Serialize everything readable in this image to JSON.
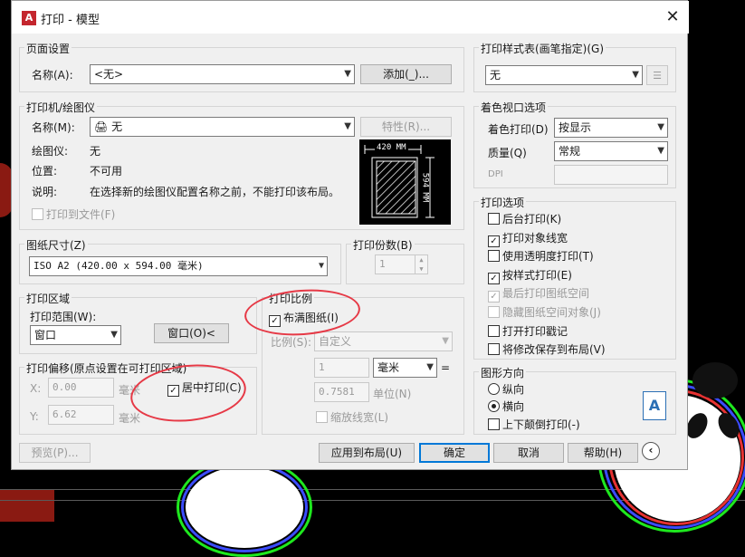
{
  "window": {
    "title": "打印 - 模型",
    "app_logo": "A",
    "close": "✕"
  },
  "page_setup": {
    "title": "页面设置",
    "name_label": "名称(A):",
    "name_value": "<无>",
    "add_button": "添加(_)..."
  },
  "printer": {
    "title": "打印机/绘图仪",
    "name_label": "名称(M):",
    "name_value": "无",
    "properties_button": "特性(R)...",
    "plotter_label": "绘图仪:",
    "plotter_value": "无",
    "location_label": "位置:",
    "location_value": "不可用",
    "description_label": "说明:",
    "description_value": "在选择新的绘图仪配置名称之前，不能打印该布局。",
    "print_to_file": "打印到文件(F)",
    "preview_width": "420 MM",
    "preview_height": "594 MM"
  },
  "paper_size": {
    "title": "图纸尺寸(Z)",
    "value": "ISO A2 (420.00 x 594.00 毫米)"
  },
  "copies": {
    "title": "打印份数(B)",
    "value": "1"
  },
  "plot_area": {
    "title": "打印区域",
    "range_label": "打印范围(W):",
    "range_value": "窗口",
    "window_button": "窗口(O)<"
  },
  "plot_offset": {
    "title": "打印偏移(原点设置在可打印区域)",
    "x_label": "X:",
    "x_value": "0.00",
    "x_unit": "毫米",
    "y_label": "Y:",
    "y_value": "6.62",
    "y_unit": "毫米",
    "center": "居中打印(C)"
  },
  "plot_scale": {
    "title": "打印比例",
    "fit_paper": "布满图纸(I)",
    "scale_label": "比例(S):",
    "scale_value": "自定义",
    "value1": "1",
    "unit_value": "毫米",
    "equals": "=",
    "value2": "0.7581",
    "unit_label": "单位(N)",
    "scale_lineweights": "缩放线宽(L)"
  },
  "plot_style": {
    "title": "打印样式表(画笔指定)(G)",
    "value": "无"
  },
  "shaded_viewport": {
    "title": "着色视口选项",
    "shade_label": "着色打印(D)",
    "shade_value": "按显示",
    "quality_label": "质量(Q)",
    "quality_value": "常规",
    "dpi_label": "DPI",
    "dpi_value": ""
  },
  "plot_options": {
    "title": "打印选项",
    "items": [
      {
        "label": "后台打印(K)",
        "checked": false,
        "disabled": false
      },
      {
        "label": "打印对象线宽",
        "checked": true,
        "disabled": false
      },
      {
        "label": "使用透明度打印(T)",
        "checked": false,
        "disabled": false
      },
      {
        "label": "按样式打印(E)",
        "checked": true,
        "disabled": false
      },
      {
        "label": "最后打印图纸空间",
        "checked": true,
        "disabled": true
      },
      {
        "label": "隐藏图纸空间对象(J)",
        "checked": false,
        "disabled": true
      },
      {
        "label": "打开打印戳记",
        "checked": false,
        "disabled": false
      },
      {
        "label": "将修改保存到布局(V)",
        "checked": false,
        "disabled": false
      }
    ]
  },
  "orientation": {
    "title": "图形方向",
    "portrait": "纵向",
    "landscape": "横向",
    "upside_down": "上下颠倒打印(-)",
    "icon_letter": "A"
  },
  "buttons": {
    "preview": "预览(P)...",
    "apply": "应用到布局(U)",
    "ok": "确定",
    "cancel": "取消",
    "help": "帮助(H)"
  },
  "check_mark": "✓",
  "colors": {
    "accent": "#0078d7",
    "annotation": "#e63946",
    "logo": "#c4262e"
  }
}
